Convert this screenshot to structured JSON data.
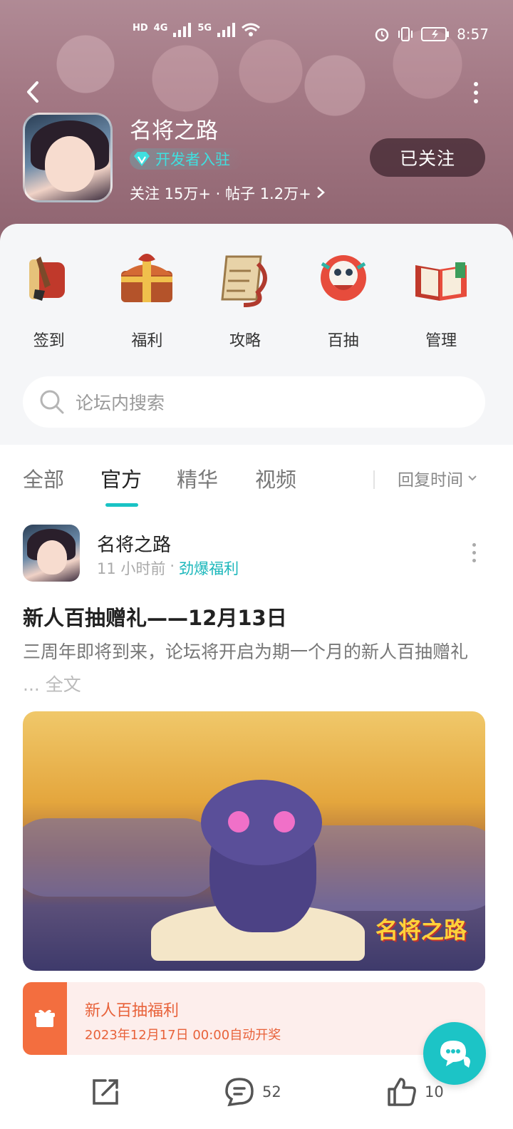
{
  "status_bar": {
    "network_labels": [
      "HD",
      "4G",
      "5G"
    ],
    "time": "8:57"
  },
  "header": {
    "forum_name": "名将之路",
    "badge": "开发者入驻",
    "stats": "关注 15万+ · 帖子 1.2万+",
    "follow_label": "已关注"
  },
  "quick_actions": [
    {
      "label": "签到",
      "icon": "brush-scroll-icon"
    },
    {
      "label": "福利",
      "icon": "treasure-chest-icon"
    },
    {
      "label": "攻略",
      "icon": "map-scroll-icon"
    },
    {
      "label": "百抽",
      "icon": "lion-dance-icon"
    },
    {
      "label": "管理",
      "icon": "book-icon"
    }
  ],
  "search": {
    "placeholder": "论坛内搜索"
  },
  "tabs": [
    {
      "label": "全部"
    },
    {
      "label": "官方"
    },
    {
      "label": "精华"
    },
    {
      "label": "视频"
    }
  ],
  "active_tab": "官方",
  "sort": {
    "label": "回复时间"
  },
  "post": {
    "author": "名将之路",
    "time": "11 小时前",
    "category": "劲爆福利",
    "title": "新人百抽赠礼——12月13日",
    "summary": "三周年即将到来，论坛将开启为期一个月的新人百抽赠礼",
    "ellipsis": "...",
    "full_text": "全文",
    "image_logo": "名将之路",
    "lottery": {
      "title": "新人百抽福利",
      "time": "2023年12月17日 00:00自动开奖"
    },
    "comments": "52",
    "likes": "10"
  },
  "colors": {
    "accent": "#19c3c5",
    "lottery": "#f36e3f"
  }
}
